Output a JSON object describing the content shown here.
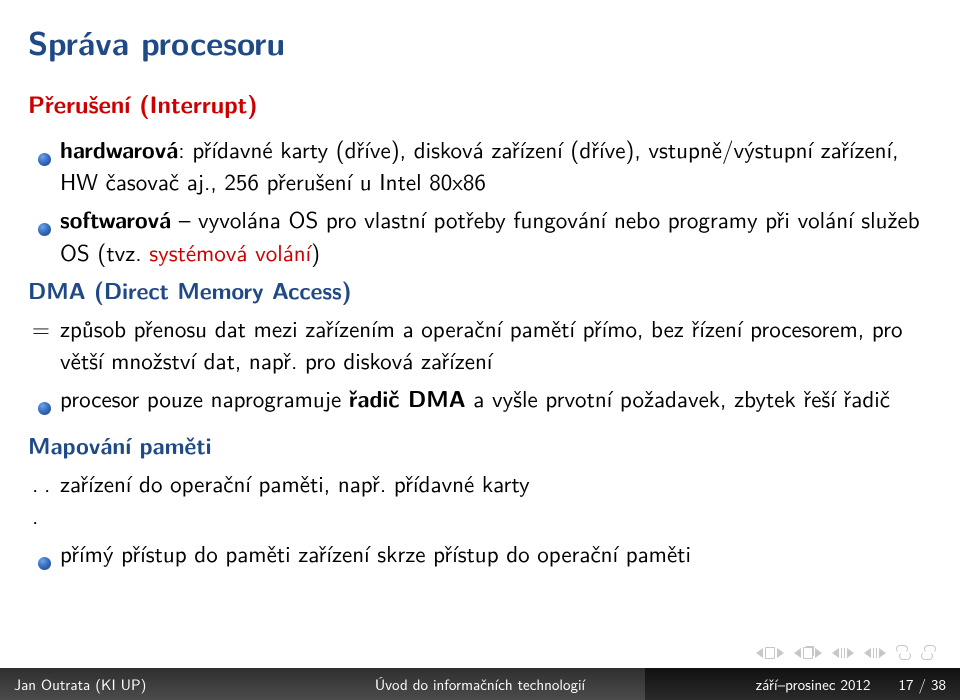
{
  "title": "Správa procesoru",
  "subtitle": "Přerušení (Interrupt)",
  "bullets": {
    "b1_bold": "hardwarová",
    "b1_rest": ": přídavné karty (dříve), disková zařízení (dříve), vstupně/výstupní zařízení, HW časovač aj., 256 přerušení u Intel 80x86",
    "b2_bold": "softwarová",
    "b2_rest_a": " – vyvolána OS pro vlastní potřeby fungování nebo programy při volání služeb OS (tvz. ",
    "b2_red": "systémová volání",
    "b2_rest_b": ")"
  },
  "dma_head": "DMA (Direct Memory Access)",
  "dma_eq": "=",
  "dma_text": "způsob přenosu dat mezi zařízením a operační pamětí přímo, bez řízení procesorem, pro větší množství dat, např. pro disková zařízení",
  "dma_b1_a": "procesor pouze naprogramuje ",
  "dma_b1_bold": "řadič DMA",
  "dma_b1_b": " a vyšle prvotní požadavek, zbytek řeší řadič",
  "map_head": "Mapování paměti",
  "map_dots": ". . .",
  "map_text": " zařízení do operační paměti, např. přídavné karty",
  "map_b1": "přímý přístup do paměti zařízení skrze přístup do operační paměti",
  "footer": {
    "left": "Jan Outrata (KI UP)",
    "mid": "Úvod do informačních technologií",
    "right_a": "září–prosinec 2012",
    "right_b": "17 / 38"
  }
}
